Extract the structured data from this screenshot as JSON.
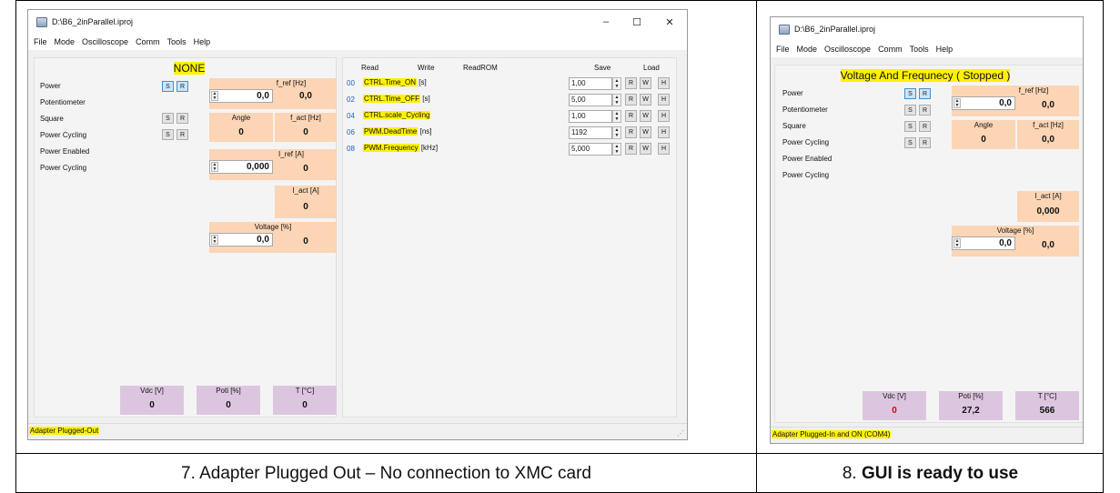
{
  "left_window": {
    "title": "D:\\B6_2inParallel.iproj",
    "menu": [
      "File",
      "Mode",
      "Oscilloscope",
      "Comm",
      "Tools",
      "Help"
    ],
    "mode": "NONE",
    "side_labels": [
      "Power",
      "Potentiometer",
      "Square",
      "Power Cycling",
      "Power Enabled",
      "Power Cycling"
    ],
    "sr_buttons": {
      "s": "S",
      "r": "R"
    },
    "f_ref": {
      "title": "f_ref [Hz]",
      "input": "0,0",
      "value": "0,0"
    },
    "angle": {
      "title": "Angle",
      "value": "0"
    },
    "f_act": {
      "title": "f_act [Hz]",
      "value": "0"
    },
    "i_ref": {
      "title": "I_ref [A]",
      "input": "0,000",
      "value": "0"
    },
    "i_act": {
      "title": "I_act [A]",
      "value": "0"
    },
    "voltage": {
      "title": "Voltage [%]",
      "input": "0,0",
      "value": "0"
    },
    "vdc": {
      "title": "Vdc [V]",
      "value": "0"
    },
    "poti": {
      "title": "Poti [%]",
      "value": "0"
    },
    "temp": {
      "title": "T [°C]",
      "value": "0"
    },
    "param_headers": {
      "read": "Read",
      "write": "Write",
      "readrom": "ReadROM",
      "save": "Save",
      "load": "Load"
    },
    "params": [
      {
        "idx": "00",
        "name": "CTRL.Time_ON",
        "unit": "[s]",
        "value": "1,00"
      },
      {
        "idx": "02",
        "name": "CTRL.Time_OFF",
        "unit": "[s]",
        "value": "5,00"
      },
      {
        "idx": "04",
        "name": "CTRL.scale_Cycling",
        "unit": "",
        "value": "1,00"
      },
      {
        "idx": "06",
        "name": "PWM.DeadTime",
        "unit": "[ns]",
        "value": "1192"
      },
      {
        "idx": "08",
        "name": "PWM.Frequency",
        "unit": "[kHz]",
        "value": "5,000"
      }
    ],
    "row_buttons": {
      "r": "R",
      "w": "W",
      "h": "H"
    },
    "status": "Adapter Plugged-Out",
    "controls": {
      "minimize": "–",
      "maximize": "☐",
      "close": "✕"
    }
  },
  "right_window": {
    "title": "D:\\B6_2inParallel.iproj",
    "menu": [
      "File",
      "Mode",
      "Oscilloscope",
      "Comm",
      "Tools",
      "Help"
    ],
    "mode": "Voltage And Frequnecy ( Stopped )",
    "side_labels": [
      "Power",
      "Potentiometer",
      "Square",
      "Power Cycling",
      "Power Enabled",
      "Power Cycling"
    ],
    "f_ref": {
      "title": "f_ref [Hz]",
      "input": "0,0",
      "value": "0,0"
    },
    "angle": {
      "title": "Angle",
      "value": "0"
    },
    "f_act": {
      "title": "f_act [Hz]",
      "value": "0,0"
    },
    "i_act": {
      "title": "I_act [A]",
      "value": "0,000"
    },
    "voltage": {
      "title": "Voltage [%]",
      "input": "0,0",
      "value": "0,0"
    },
    "vdc": {
      "title": "Vdc [V]",
      "value": "0"
    },
    "poti": {
      "title": "Poti [%]",
      "value": "27,2"
    },
    "temp": {
      "title": "T [°C]",
      "value": "566"
    },
    "status": "Adapter Plugged-In and ON (COM4)"
  },
  "captions": {
    "left": "7. Adapter Plugged Out – No connection to XMC card",
    "right_num": "8. ",
    "right_bold": "GUI is ready to use"
  },
  "colors": {
    "highlight": "#fff200",
    "orange_box": "#fcd5b5",
    "purple_box": "#dcc6df",
    "vdc_red": "#e00000"
  }
}
